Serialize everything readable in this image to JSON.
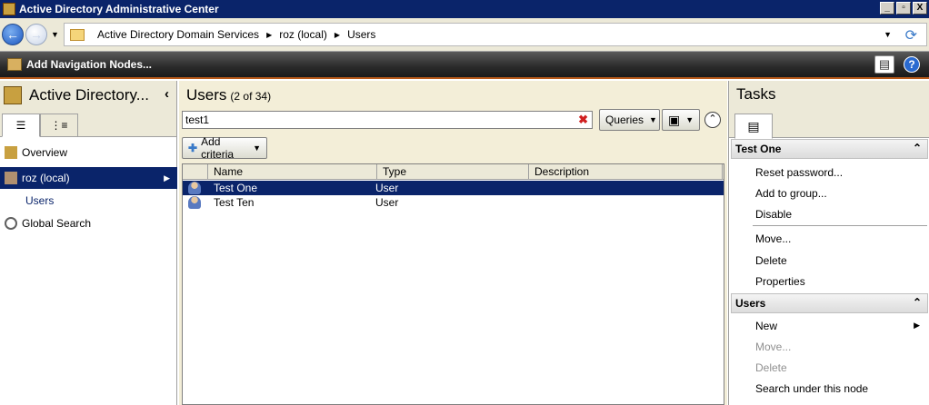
{
  "window": {
    "title": "Active Directory Administrative Center",
    "buttons": [
      "_",
      "▫",
      "X"
    ]
  },
  "address": {
    "breadcrumbs": [
      "Active Directory Domain Services",
      "roz (local)",
      "Users"
    ]
  },
  "toolbar": {
    "add_nodes_label": "Add Navigation Nodes..."
  },
  "left": {
    "title": "Active Directory...",
    "collapse_glyph": "‹",
    "tree": [
      {
        "label": "Overview"
      },
      {
        "label": "roz (local)"
      },
      {
        "label": "Users"
      },
      {
        "label": "Global Search"
      }
    ]
  },
  "center": {
    "title": "Users",
    "count": "(2 of 34)",
    "search_value": "test1",
    "queries_label": "Queries",
    "add_criteria_label": "Add criteria",
    "columns": [
      "Name",
      "Type",
      "Description"
    ],
    "rows": [
      {
        "name": "Test One",
        "type": "User",
        "description": ""
      },
      {
        "name": "Test Ten",
        "type": "User",
        "description": ""
      }
    ]
  },
  "tasks": {
    "title": "Tasks",
    "sections": [
      {
        "header": "Test One",
        "items": [
          "Reset password...",
          "Add to group...",
          "Disable",
          "Move...",
          "Delete",
          "Properties"
        ]
      },
      {
        "header": "Users",
        "items": [
          "New",
          "Move...",
          "Delete",
          "Search under this node"
        ]
      }
    ]
  },
  "colors": {
    "selection": "#0a246a",
    "accent_bar": "#b85a1a",
    "center_bg": "#f3eed8"
  }
}
